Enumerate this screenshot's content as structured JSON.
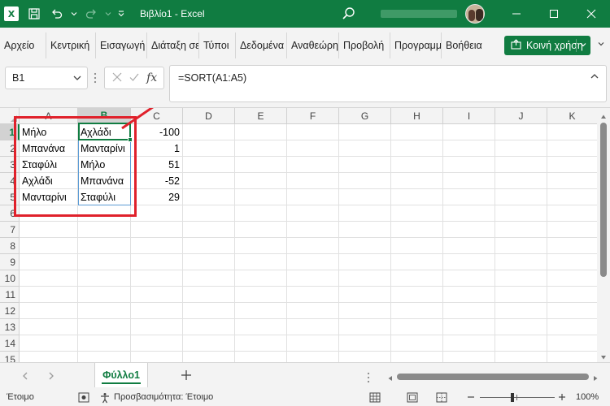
{
  "window": {
    "title": "Βιβλίο1 - Excel",
    "brand_color": "#107c41"
  },
  "menu": {
    "items": [
      "Αρχείο",
      "Κεντρική",
      "Εισαγωγή",
      "Διάταξη σελίδας",
      "Τύποι",
      "Δεδομένα",
      "Αναθεώρηση",
      "Προβολή",
      "Προγραμματιστής",
      "Βοήθεια"
    ],
    "share_label": "Κοινή χρήση"
  },
  "formula_bar": {
    "name_box": "B1",
    "fx_label": "fx",
    "formula": "=SORT(A1:A5)"
  },
  "grid": {
    "columns": [
      "A",
      "B",
      "C",
      "D",
      "E",
      "F",
      "G",
      "H",
      "I",
      "J",
      "K"
    ],
    "rows": [
      "1",
      "2",
      "3",
      "4",
      "5",
      "6",
      "7",
      "8",
      "9",
      "10",
      "11",
      "12",
      "13",
      "14",
      "15"
    ],
    "selected_column": "B",
    "selected_row": "1",
    "col_a": [
      "Μήλο",
      "Μπανάνα",
      "Σταφύλι",
      "Αχλάδι",
      "Μανταρίνι"
    ],
    "col_b": [
      "Αχλάδι",
      "Μανταρίνι",
      "Μήλο",
      "Μπανάνα",
      "Σταφύλι"
    ],
    "col_c": [
      "-100",
      "1",
      "51",
      "-52",
      "29"
    ]
  },
  "sheets": {
    "active": "Φύλλο1"
  },
  "status": {
    "ready": "Έτοιμο",
    "accessibility": "Προσβασιμότητα: Έτοιμο",
    "zoom": "100%"
  },
  "annotation": {
    "color": "#e0212b"
  }
}
